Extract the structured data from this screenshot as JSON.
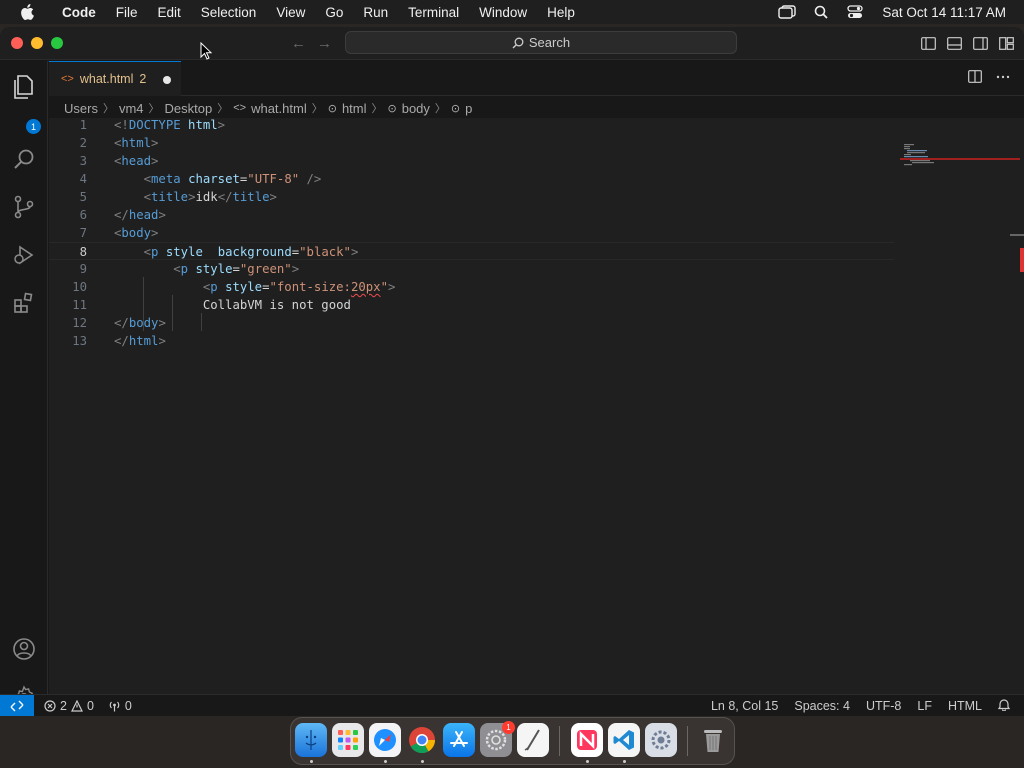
{
  "menubar": {
    "app_name": "Code",
    "items": [
      "File",
      "Edit",
      "Selection",
      "View",
      "Go",
      "Run",
      "Terminal",
      "Window",
      "Help"
    ],
    "clock": "Sat Oct 14  11:17 AM"
  },
  "titlebar": {
    "search_label": "Search"
  },
  "activity_bar": {
    "explorer_badge": "1"
  },
  "tab": {
    "filename": "what.html",
    "problem_count": "2"
  },
  "breadcrumb": [
    "Users",
    "vm4",
    "Desktop",
    "what.html",
    "html",
    "body",
    "p"
  ],
  "editor": {
    "current_line": 8,
    "line_numbers": [
      "1",
      "2",
      "3",
      "4",
      "5",
      "6",
      "7",
      "8",
      "9",
      "10",
      "11",
      "12",
      "13"
    ]
  },
  "statusbar": {
    "errors": "2",
    "warnings": "0",
    "ports": "0",
    "cursor_position": "Ln 8, Col 15",
    "indentation": "Spaces: 4",
    "encoding": "UTF-8",
    "eol": "LF",
    "language": "HTML"
  },
  "colors": {
    "accent": "#0078d4",
    "editor_bg": "#1f1f1f",
    "tab_modified_text": "#e2c08d",
    "error_squiggle": "#f14c4c"
  }
}
